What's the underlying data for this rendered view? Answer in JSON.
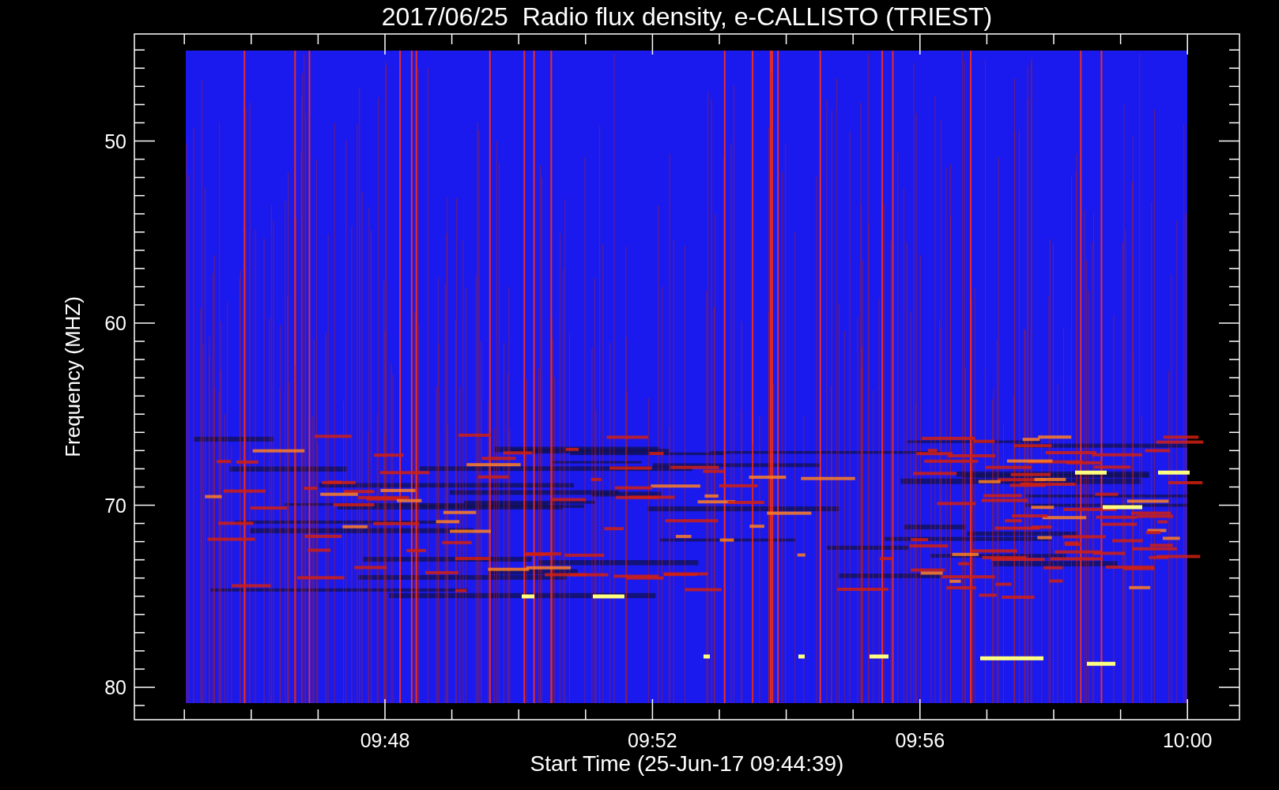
{
  "title": "2017/06/25  Radio flux density, e-CALLISTO (TRIEST)",
  "y_axis": {
    "label": "Frequency (MHZ)",
    "ticks": [
      "50",
      "60",
      "70",
      "80"
    ]
  },
  "x_axis": {
    "label": "Start Time (25-Jun-17 09:44:39)",
    "ticks": [
      "09:48",
      "09:52",
      "09:56",
      "10:00"
    ]
  }
}
